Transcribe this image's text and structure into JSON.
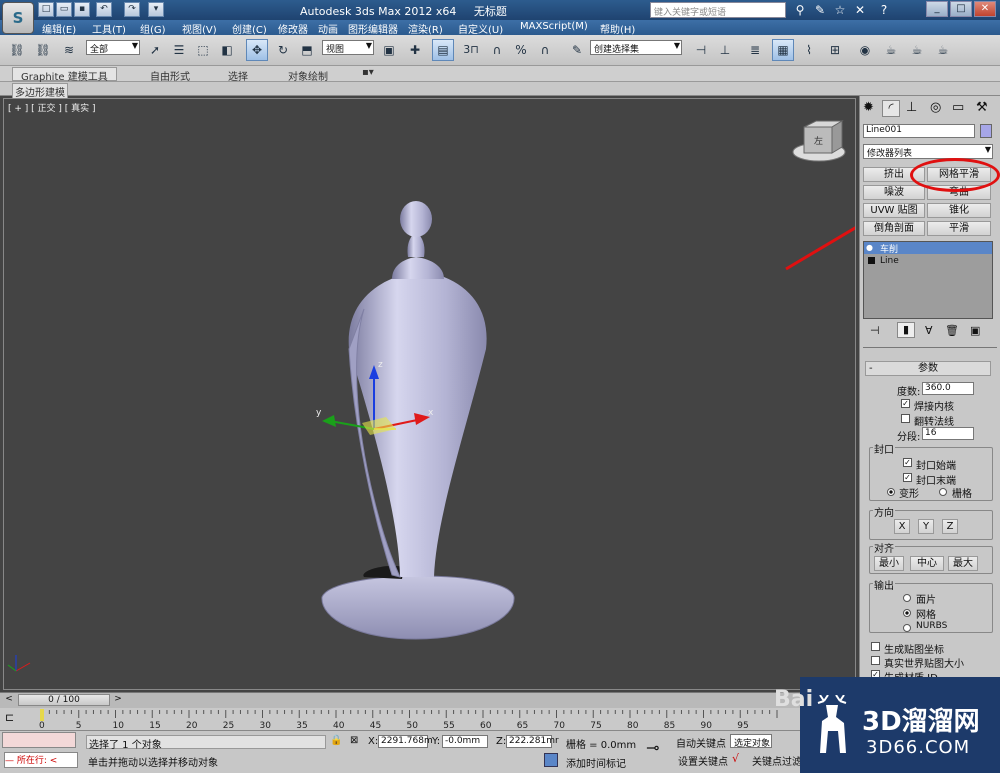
{
  "title_bar": {
    "app_logo_letter": "S",
    "title": "Autodesk 3ds Max  2012 x64",
    "document": "无标题",
    "search_placeholder": "键入关键字或短语"
  },
  "menu": [
    "编辑(E)",
    "工具(T)",
    "组(G)",
    "视图(V)",
    "创建(C)",
    "修改器",
    "动画",
    "图形编辑器",
    "渲染(R)",
    "自定义(U)",
    "MAXScript(M)",
    "帮助(H)"
  ],
  "toolbar": {
    "selection_filter": "全部",
    "reference_coord": "视图",
    "named_selection": "创建选择集",
    "snap_label": "3"
  },
  "ribbon": {
    "tabs": [
      "Graphite 建模工具",
      "自由形式",
      "选择",
      "对象绘制"
    ],
    "sub_tab": "多边形建模"
  },
  "viewport": {
    "label": "[ + ] [ 正交 ] [ 真实 ]",
    "viewcube_face": "左",
    "gizmo_x": "x",
    "gizmo_y": "y",
    "gizmo_z": "z",
    "corner_axes": "x y z"
  },
  "command_panel": {
    "object_name": "Line001",
    "modifier_list": "修改器列表",
    "modifier_buttons": [
      "挤出",
      "网格平滑",
      "噪波",
      "弯曲",
      "UVW 贴图",
      "锥化",
      "倒角剖面",
      "平滑"
    ],
    "stack": [
      "车削",
      "Line"
    ],
    "rollout_title": "参数",
    "degrees_label": "度数:",
    "degrees_value": "360.0",
    "weld_core": "焊接内核",
    "flip_normals": "翻转法线",
    "segments_label": "分段:",
    "segments_value": "16",
    "cap_group": "封口",
    "cap_start": "封口始端",
    "cap_end": "封口末端",
    "morph": "变形",
    "grid": "栅格",
    "direction_group": "方向",
    "dir_x": "X",
    "dir_y": "Y",
    "dir_z": "Z",
    "align_group": "对齐",
    "align_min": "最小",
    "align_center": "中心",
    "align_max": "最大",
    "output_group": "输出",
    "out_patch": "面片",
    "out_mesh": "网格",
    "out_nurbs": "NURBS",
    "gen_mapping": "生成贴图坐标",
    "real_world": "真实世界贴图大小",
    "gen_mat_id": "生成材质 ID"
  },
  "timeline": {
    "frame_counter": "0 / 100",
    "ticks": [
      "0",
      "5",
      "10",
      "15",
      "20",
      "25",
      "30",
      "35",
      "40",
      "45",
      "50",
      "55",
      "60",
      "65",
      "70",
      "75",
      "80",
      "85",
      "90",
      "95"
    ]
  },
  "status": {
    "current_cmd": "所在行:",
    "selected": "选择了 1 个对象",
    "hint": "单击并拖动以选择并移动对象",
    "x_label": "X:",
    "x_value": "2291.768m",
    "y_label": "Y:",
    "y_value": "-0.0mm",
    "z_label": "Z:",
    "z_value": "222.281mr",
    "grid_value": "栅格 = 0.0mm",
    "auto_key": "自动关键点",
    "set_key": "设置关键点",
    "selected_set": "选定对象",
    "add_time_tag": "添加时间标记",
    "key_filters": "关键点过滤"
  },
  "watermark": {
    "brand": "3D溜溜网",
    "url": "3D66.COM",
    "baidu": "Bai"
  },
  "colors": {
    "viewport_bg": "#444444",
    "model_color": "#b4b4d4",
    "annotation_red": "#e01010",
    "stack_highlight": "#5a86c8"
  }
}
